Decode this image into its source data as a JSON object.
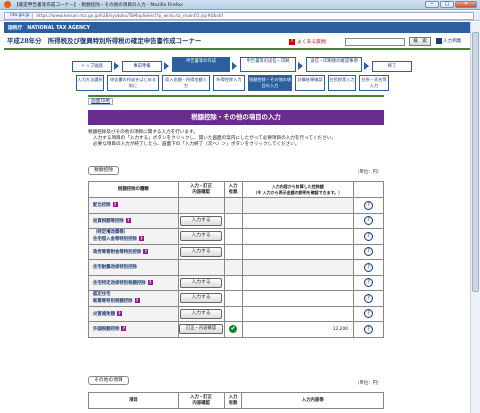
{
  "window": {
    "title": "【確定申告書等作成コーナー】- 税額控除・その他の項目の入力 - Mozilla Firefox",
    "minimize": "─",
    "maximize": "□",
    "close": "✕"
  },
  "address": {
    "domain": "nta.go.jp",
    "url": "https://www.keisan.nta.go.jp/h28/syotoku/TaMapSelect?p_wnd=ta_main01.jsp#bbckf"
  },
  "agency_bar": "国税庁　NATIONAL TAX AGENCY",
  "header": {
    "title": "平成28年分　所得税及び復興特別所得税の確定申告書作成コーナー",
    "help_label": "よくある質問",
    "search_button": "検　索",
    "input_example": "入力例集"
  },
  "steps": {
    "top": [
      "トップ画面",
      "事前準備",
      "申告書等の作成",
      "申告書等の送信・印刷",
      "送信・印刷後の確認事項",
      "終了"
    ],
    "sub": [
      "入力方法選択",
      "申告書の作成をはじめる前に",
      "収入金額・所得金額入力",
      "所得控除入力",
      "税額控除・その他の項目の入力",
      "計算結果確認",
      "住民税等入力",
      "住所・氏名等入力"
    ]
  },
  "print_link": "画面印刷",
  "page_title": "税額控除・その他の項目の入力",
  "intro": [
    "税額控除及びその他の項目に関する入力を行います。",
    "入力する項目の「入力する」ボタンをクリックし、開いた画面の案内にしたがって必要項目の入力を行ってください。",
    "必要な項目の入力が終了したら、画面下の「入力終了（次へ）＞」ボタンをクリックしてください。"
  ],
  "section1": {
    "label": "税額控除",
    "unit": "（単位：円）",
    "headers": [
      "税額控除の種類",
      "入力・訂正\n内容確認",
      "入力\n有無",
      "入力内容から計算した控除額\n（※ 入力から表示金額の説明を確認できます。）"
    ],
    "rows": [
      {
        "name": "配当控除",
        "button": "",
        "done": false,
        "amount": ""
      },
      {
        "name": "投資税額等控除",
        "button": "入力する",
        "done": false,
        "amount": ""
      },
      {
        "name": "（特定増改築等）\n住宅借入金等特別控除",
        "button": "入力する",
        "done": false,
        "amount": ""
      },
      {
        "name": "政党等寄附金等特別控除",
        "button": "入力する",
        "done": false,
        "amount": ""
      },
      {
        "name": "住宅耐震改修特別控除",
        "button": "",
        "done": false,
        "amount": ""
      },
      {
        "name": "住宅特定改修特別税額控除",
        "button": "入力する",
        "done": false,
        "amount": ""
      },
      {
        "name": "認定住宅\n新築等特別税額控除",
        "button": "入力する",
        "done": false,
        "amount": ""
      },
      {
        "name": "災害減免額",
        "button": "入力する",
        "done": false,
        "amount": ""
      },
      {
        "name": "外国税額控除",
        "button": "訂正・内容確認",
        "done": true,
        "amount": "12,200"
      }
    ]
  },
  "section2": {
    "label": "その他の項目",
    "unit": "（単位：円）",
    "headers": [
      "項目",
      "入力・訂正\n内容確認",
      "入力\n有無",
      "入力内容等"
    ]
  }
}
